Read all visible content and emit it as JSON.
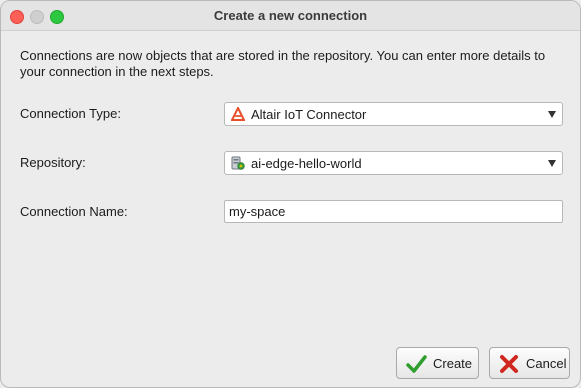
{
  "window": {
    "title": "Create a new connection"
  },
  "description": "Connections are now objects that are stored in the repository. You can enter more details to your connection in the next steps.",
  "form": {
    "connection_type": {
      "label": "Connection Type:",
      "value": "Altair IoT Connector",
      "icon": "altair-logo-icon"
    },
    "repository": {
      "label": "Repository:",
      "value": "ai-edge-hello-world",
      "icon": "repository-icon"
    },
    "connection_name": {
      "label": "Connection Name:",
      "value": "my-space"
    }
  },
  "buttons": {
    "create": {
      "label": "Create",
      "icon": "checkmark-icon"
    },
    "cancel": {
      "label": "Cancel",
      "icon": "x-icon"
    }
  },
  "colors": {
    "close": "#fe5f57",
    "minimize": "#cfcfcf",
    "zoom": "#2bc840",
    "altair": "#e8502b",
    "check": "#2f9e2f",
    "cancel_x": "#d0281e"
  }
}
